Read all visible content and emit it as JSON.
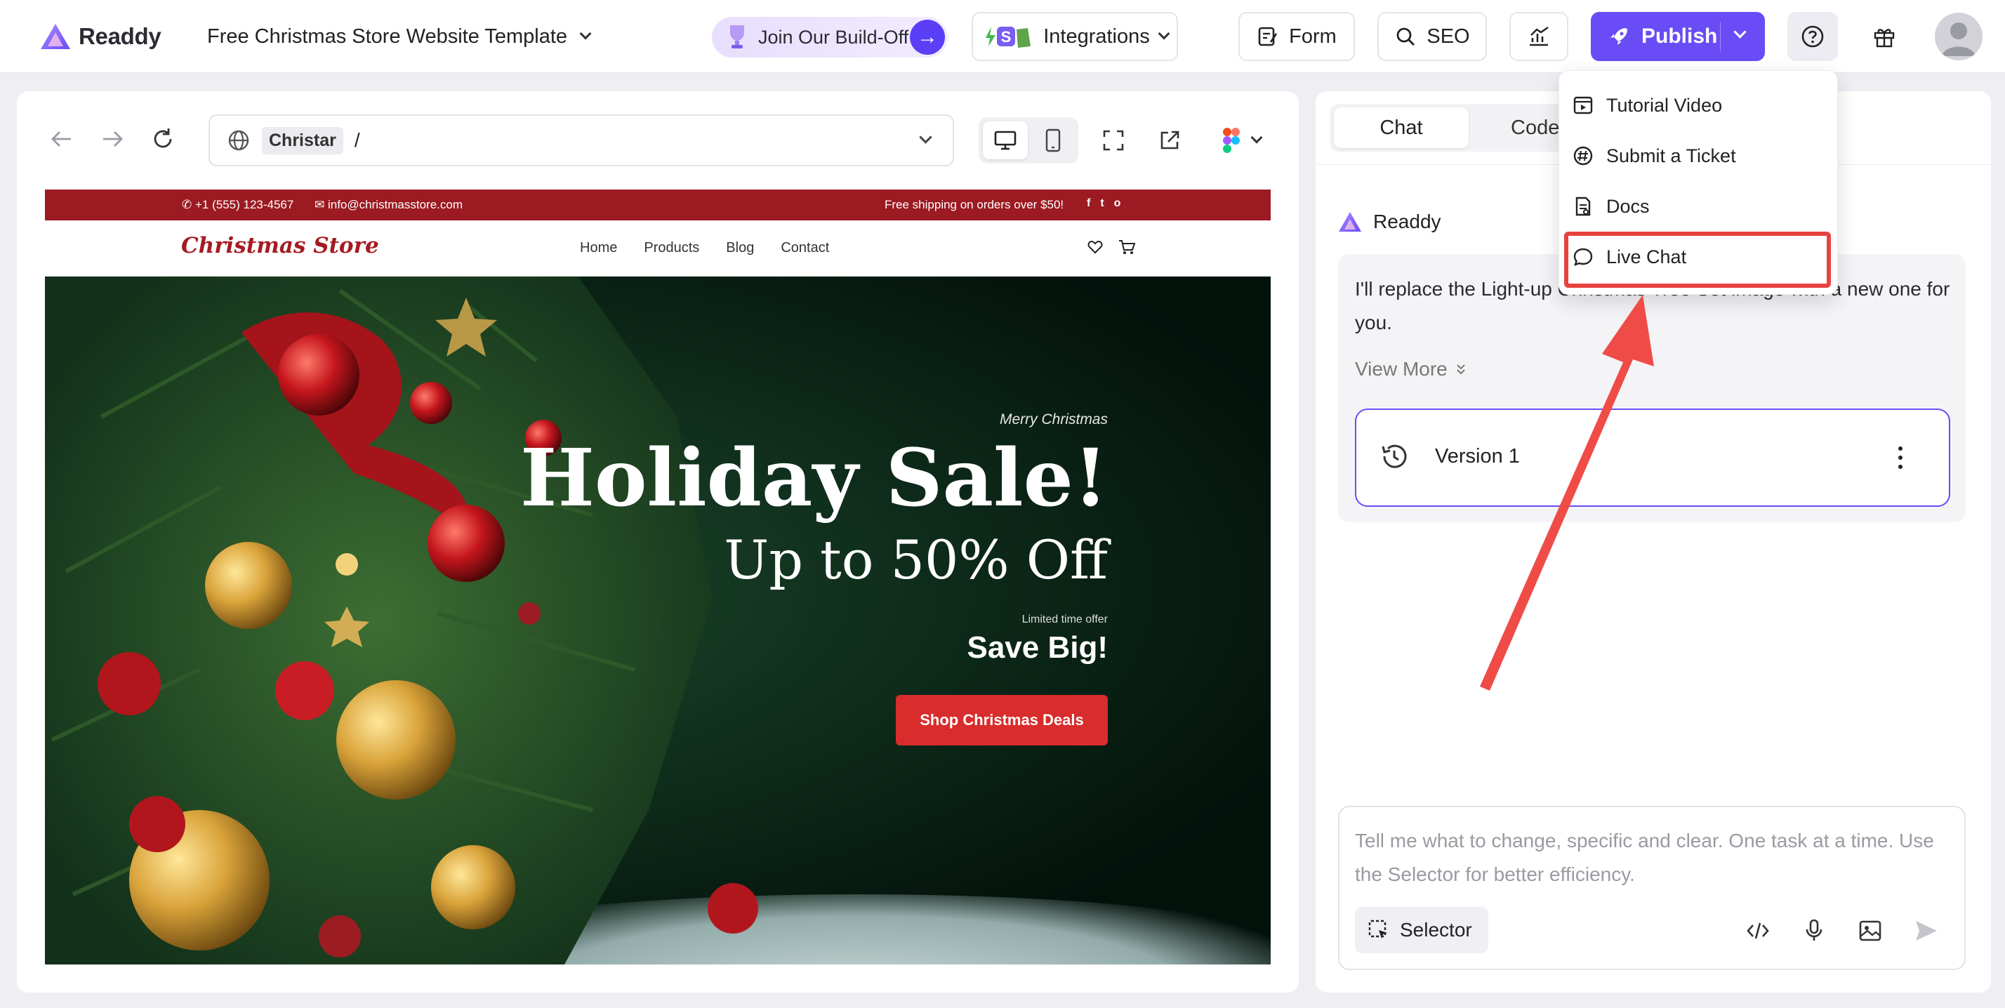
{
  "app": {
    "name": "Readdy",
    "project_title": "Free Christmas Store Website Template"
  },
  "header": {
    "buildoff_label": "Join Our Build-Off",
    "integrations_label": "Integrations",
    "form_label": "Form",
    "seo_label": "SEO",
    "publish_label": "Publish",
    "publish_color": "#6a4cf6"
  },
  "browser": {
    "site_chip": "Christar",
    "path": "/"
  },
  "preview": {
    "phone": "+1 (555) 123-4567",
    "email": "info@christmasstore.com",
    "shipping": "Free shipping on orders over $50!",
    "social": [
      "f",
      "t",
      "o"
    ],
    "brand": "Christmas Store",
    "menu": [
      "Home",
      "Products",
      "Blog",
      "Contact"
    ],
    "hero": {
      "kicker": "Merry Christmas",
      "headline": "Holiday Sale!",
      "subheadline": "Up to 50% Off",
      "limited": "Limited time offer",
      "save": "Save Big!",
      "cta": "Shop Christmas Deals"
    },
    "accent": "#9c1a22"
  },
  "panel": {
    "tabs": [
      {
        "label": "Chat",
        "active": true
      },
      {
        "label": "Code",
        "active": false
      }
    ],
    "sender": "Readdy",
    "message": "I'll replace the Light-up Christmas Tree Set image with a new one for you.",
    "view_more": "View More",
    "version_label": "Version 1",
    "composer_placeholder": "Tell me what to change, specific and clear. One task at a time. Use the Selector for better efficiency.",
    "selector_label": "Selector"
  },
  "help_menu": {
    "items": [
      {
        "label": "Tutorial Video",
        "icon": "video-icon"
      },
      {
        "label": "Submit a Ticket",
        "icon": "hash-icon"
      },
      {
        "label": "Docs",
        "icon": "docs-icon"
      },
      {
        "label": "Live Chat",
        "icon": "chat-bubble-icon",
        "highlighted": true
      }
    ],
    "highlight_color": "#e8423f"
  }
}
